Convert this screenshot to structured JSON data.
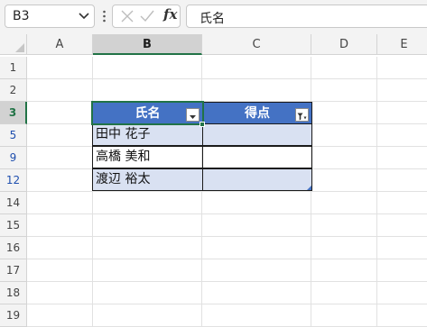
{
  "formula_bar": {
    "name_box": "B3",
    "formula_content": "氏名",
    "fx_label": "fx"
  },
  "columns": [
    "A",
    "B",
    "C",
    "D",
    "E"
  ],
  "selected_column": "B",
  "rows": [
    "1",
    "2",
    "3",
    "5",
    "9",
    "12",
    "14",
    "15",
    "16",
    "17",
    "18",
    "19"
  ],
  "selected_row": "3",
  "table": {
    "headers": [
      "氏名",
      "得点"
    ],
    "rows": [
      [
        "田中 花子",
        ""
      ],
      [
        "高橋 美和",
        ""
      ],
      [
        "渡辺 裕太",
        ""
      ]
    ],
    "header_color": "#4472c4",
    "band_color": "#d9e1f2"
  },
  "colors": {
    "selection": "#217346",
    "filtered_row_numbers": "#1f4fae"
  },
  "icons": {
    "b_filter": "dropdown-arrow-icon",
    "c_filter": "filter-funnel-icon"
  }
}
